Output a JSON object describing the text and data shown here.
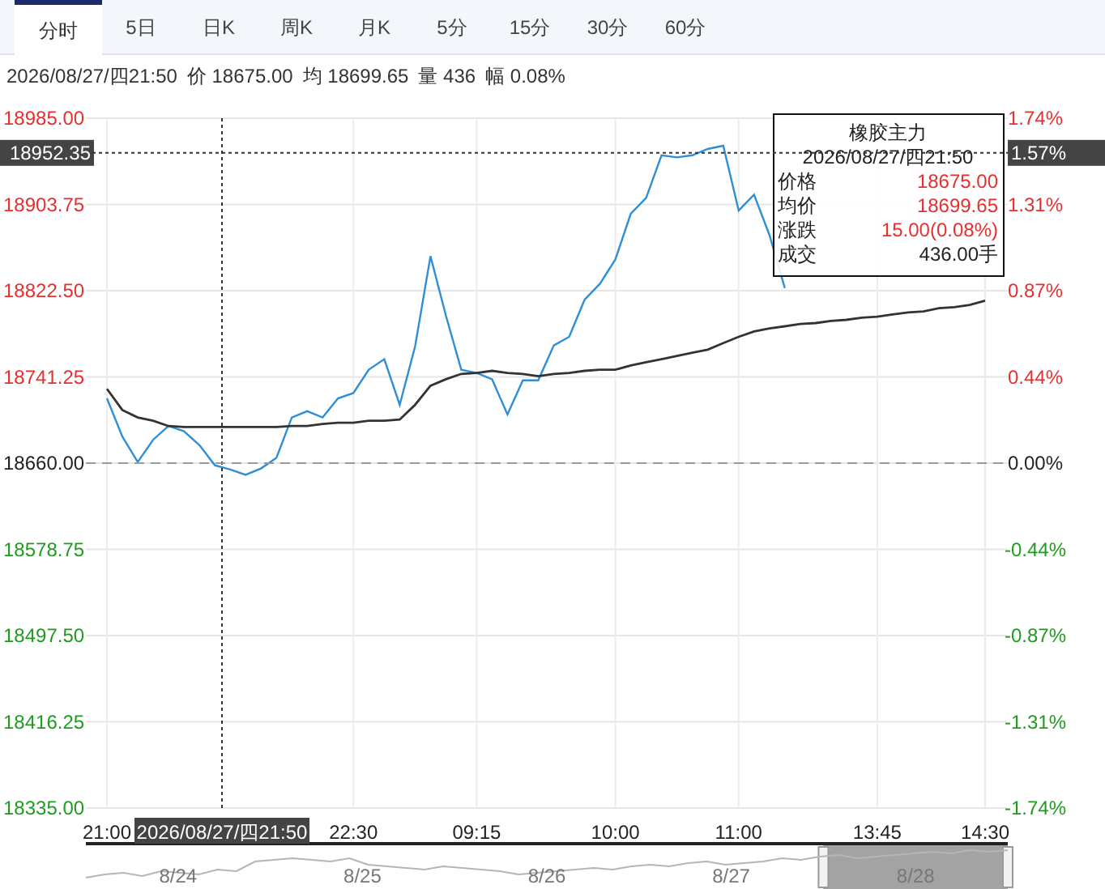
{
  "tabs": [
    {
      "label": "分时",
      "selected": true
    },
    {
      "label": "5日",
      "selected": false
    },
    {
      "label": "日K",
      "selected": false
    },
    {
      "label": "周K",
      "selected": false
    },
    {
      "label": "月K",
      "selected": false
    },
    {
      "label": "5分",
      "selected": false
    },
    {
      "label": "15分",
      "selected": false
    },
    {
      "label": "30分",
      "selected": false
    },
    {
      "label": "60分",
      "selected": false
    }
  ],
  "info_bar": {
    "time": "2026/08/27/四21:50",
    "items": [
      "价 18675.00",
      "均 18699.65",
      "量 436",
      "幅 0.08%"
    ]
  },
  "chart": {
    "chart_data": {
      "type": "line",
      "grid": true,
      "categories": [
        "21:00",
        null,
        null,
        null,
        null,
        null,
        null,
        null,
        null,
        null,
        null,
        null,
        null,
        null,
        null,
        null,
        "22:30",
        null,
        null,
        null,
        null,
        null,
        null,
        null,
        "09:15",
        null,
        null,
        null,
        null,
        null,
        null,
        null,
        null,
        "10:00",
        null,
        null,
        null,
        null,
        null,
        null,
        null,
        "11:00",
        null,
        null,
        null,
        null,
        null,
        null,
        null,
        null,
        "13:45",
        null,
        null,
        null,
        null,
        null,
        null,
        "14:30"
      ],
      "series": [
        {
          "color": "#2f8fd6",
          "values": [
            18721,
            18685,
            18661,
            18682,
            18695,
            18690,
            18677,
            18658,
            18654,
            18649,
            18655,
            18665,
            18703,
            18709,
            18703,
            18721,
            18726,
            18748,
            18758,
            18715,
            18770,
            18855,
            18799,
            18748,
            18745,
            18739,
            18706,
            18738,
            18738,
            18771,
            18779,
            18814,
            18829,
            18852,
            18895,
            18910,
            18950,
            18948,
            18950,
            18956,
            18959,
            18898,
            18913,
            18875,
            18825,
            null,
            null,
            null,
            null,
            null,
            null,
            null,
            null,
            null,
            null,
            null,
            null,
            null
          ]
        },
        {
          "color": "#333333",
          "values": [
            18730,
            18710,
            18703,
            18700,
            18695,
            18694,
            18694,
            18694,
            18694,
            18694,
            18694,
            18694,
            18695,
            18695,
            18697,
            18698,
            18698,
            18700,
            18700,
            18701,
            18715,
            18733,
            18739,
            18744,
            18745,
            18747,
            18745,
            18744,
            18742,
            18744,
            18745,
            18747,
            18748,
            18748,
            18752,
            18755,
            18758,
            18761,
            18764,
            18767,
            18773,
            18779,
            18784,
            18787,
            18789,
            18791,
            18792,
            18794,
            18795,
            18797,
            18798,
            18800,
            18802,
            18803,
            18806,
            18807,
            18809,
            18813
          ]
        }
      ],
      "ylim": [
        18335,
        18985
      ],
      "yticks": [
        {
          "value": 18985,
          "label": "18985.00"
        },
        {
          "value": 18903.75,
          "label": "18903.75"
        },
        {
          "value": 18822.5,
          "label": "18822.50"
        },
        {
          "value": 18741.25,
          "label": "18741.25"
        },
        {
          "value": 18660,
          "label": "18660.00"
        },
        {
          "value": 18578.75,
          "label": "18578.75"
        },
        {
          "value": 18497.5,
          "label": "18497.50"
        },
        {
          "value": 18416.25,
          "label": "18416.25"
        },
        {
          "value": 18335,
          "label": "18335.00"
        }
      ]
    },
    "crosshair": {
      "price_label": "18952.35",
      "percent_label": "1.57%",
      "time_label": "2026/08/27/四21:50"
    },
    "right_axis": [
      {
        "label": "1.74%",
        "color": "#e5302f"
      },
      {
        "label": "1.31%",
        "color": "#e5302f"
      },
      {
        "label": "0.87%",
        "color": "#e5302f"
      },
      {
        "label": "0.44%",
        "color": "#e5302f"
      },
      {
        "label": "0.00%",
        "color": "#222222"
      },
      {
        "label": "-0.44%",
        "color": "#1f9b1f"
      },
      {
        "label": "-0.87%",
        "color": "#1f9b1f"
      },
      {
        "label": "-1.31%",
        "color": "#1f9b1f"
      },
      {
        "label": "-1.74%",
        "color": "#1f9b1f"
      }
    ],
    "tooltip": {
      "title": "橡胶主力",
      "time": "2026/08/27/四21:50",
      "rows": [
        {
          "label": "价格",
          "value": "18675.00",
          "color": "#e5302f"
        },
        {
          "label": "均价",
          "value": "18699.65",
          "color": "#e5302f"
        },
        {
          "label": "涨跌",
          "value": "15.00(0.08%)",
          "color": "#e5302f"
        },
        {
          "label": "成交",
          "value": "436.00手",
          "color": "#222222"
        }
      ]
    }
  },
  "navigator": {
    "days": [
      {
        "label": "8/24",
        "selected": false
      },
      {
        "label": "8/25",
        "selected": false
      },
      {
        "label": "8/26",
        "selected": false
      },
      {
        "label": "8/27",
        "selected": false
      },
      {
        "label": "8/28",
        "selected": true
      }
    ]
  }
}
